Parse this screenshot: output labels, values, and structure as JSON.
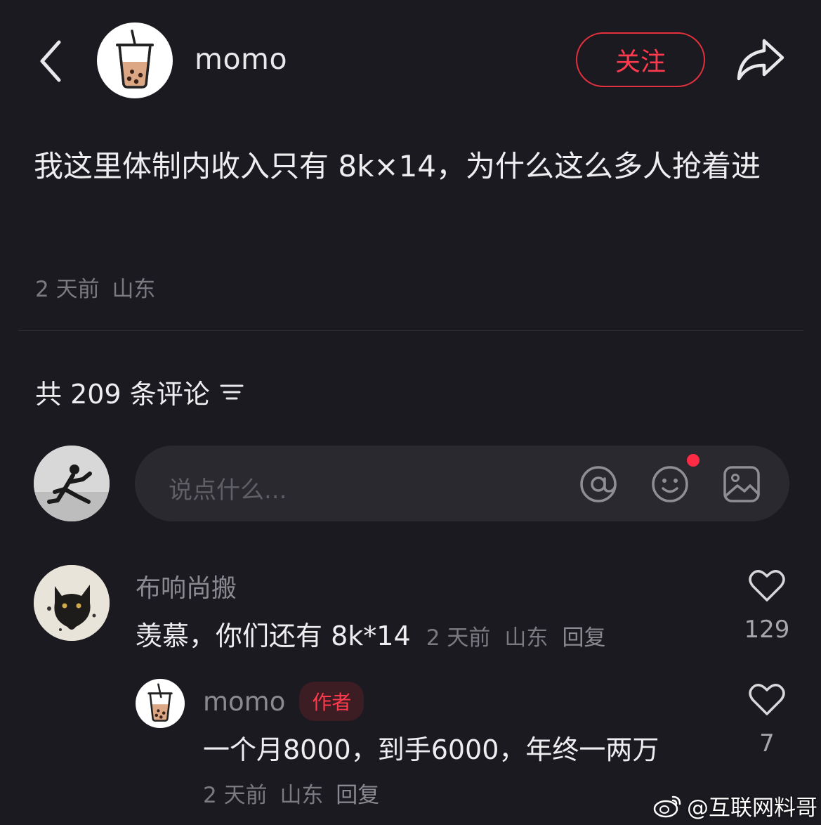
{
  "header": {
    "author_name": "momo",
    "follow_label": "关注"
  },
  "post": {
    "text": "我这里体制内收入只有 8k×14，为什么这么多人抢着进",
    "time": "2 天前",
    "location": "山东"
  },
  "comments_header": {
    "count_label": "共 209 条评论"
  },
  "comment_input": {
    "placeholder": "说点什么..."
  },
  "comments": [
    {
      "user": "布响尚搬",
      "text": "羡慕，你们还有 8k*14",
      "time": "2 天前",
      "location": "山东",
      "reply_label": "回复",
      "likes": "129"
    },
    {
      "user": "momo",
      "badge": "作者",
      "text": "一个月8000，到手6000，年终一两万",
      "time": "2 天前",
      "location": "山东",
      "reply_label": "回复",
      "likes": "7"
    }
  ],
  "watermark": {
    "text": "@互联网料哥"
  },
  "colors": {
    "background": "#1b1a21",
    "accent_red": "#ff3a4d",
    "input_bg": "#2a2930"
  },
  "icons": [
    "back-arrow-icon",
    "bubble-tea-avatar-icon",
    "share-arrow-icon",
    "filter-icon",
    "at-icon",
    "emoji-icon",
    "image-icon",
    "heart-icon",
    "weibo-icon"
  ]
}
